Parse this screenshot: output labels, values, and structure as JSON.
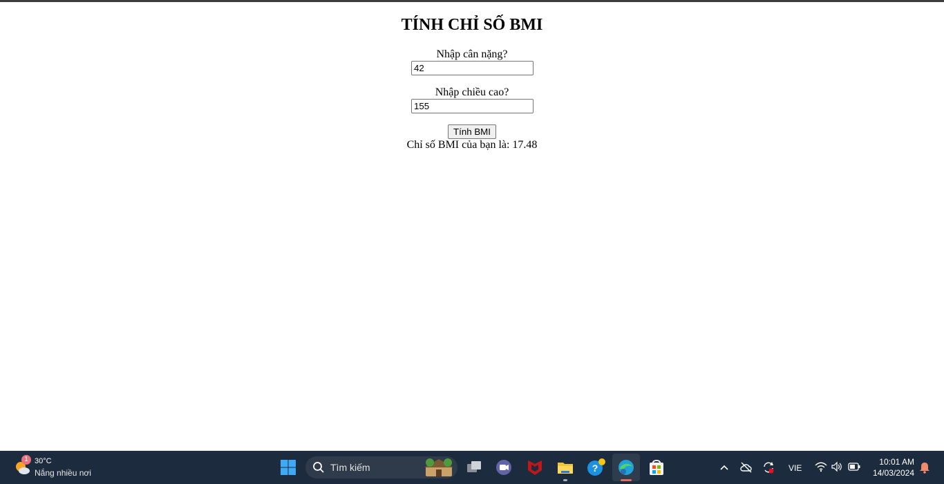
{
  "form": {
    "title": "TÍNH CHỈ SỐ BMI",
    "weight_label": "Nhập cân nặng?",
    "weight_value": "42",
    "height_label": "Nhập chiều cao?",
    "height_value": "155",
    "submit_label": "Tính BMI",
    "result_text": "Chỉ số BMI của bạn là: 17.48"
  },
  "taskbar": {
    "weather_badge": "1",
    "weather_temp": "30°C",
    "weather_desc": "Nắng nhiều nơi",
    "search_placeholder": "Tìm kiếm",
    "pinned": [
      "windows-start",
      "search",
      "task-view",
      "teams",
      "mcafee",
      "file-explorer",
      "help",
      "edge",
      "store"
    ],
    "language": "VIE",
    "time": "10:01 AM",
    "date": "14/03/2024"
  },
  "colors": {
    "taskbar_bg": "#1c2b3e",
    "page_bg": "#ffffff",
    "mcafee_red": "#c01818",
    "edge_accent": "#e46d5a"
  }
}
